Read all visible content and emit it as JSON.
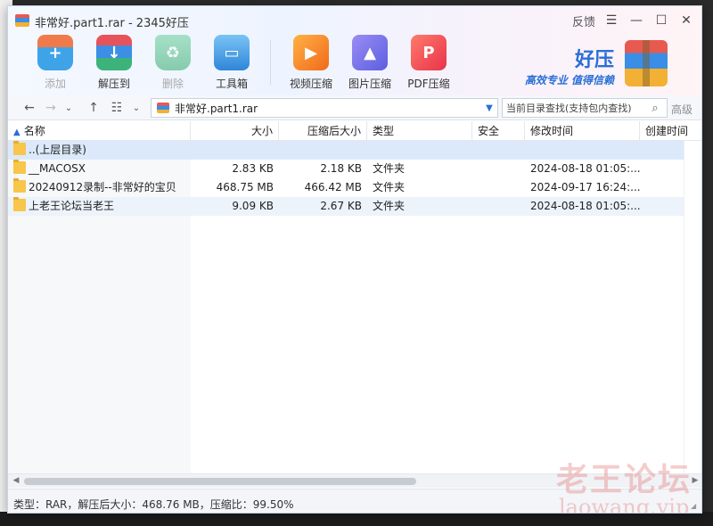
{
  "window": {
    "title": "非常好.part1.rar - 2345好压",
    "feedback_label": "反馈",
    "menu_icon": "hamburger-icon",
    "minimize_icon": "minimize-icon",
    "maximize_icon": "maximize-icon",
    "close_icon": "close-icon"
  },
  "toolbar": {
    "add_label": "添加",
    "extract_label": "解压到",
    "delete_label": "删除",
    "toolbox_label": "工具箱",
    "video_label": "视频压缩",
    "image_label": "图片压缩",
    "pdf_label": "PDF压缩"
  },
  "brand": {
    "name": "好压",
    "slogan": "高效专业  值得信赖"
  },
  "nav": {
    "path": "非常好.part1.rar",
    "search_placeholder": "当前目录查找(支持包内查找)",
    "advanced_label": "高级"
  },
  "table": {
    "headers": {
      "name": "名称",
      "size": "大小",
      "packed": "压缩后大小",
      "type": "类型",
      "security": "安全",
      "modified": "修改时间",
      "created": "创建时间"
    },
    "rows": [
      {
        "name": "..(上层目录)",
        "size": "",
        "packed": "",
        "type": "",
        "modified": ""
      },
      {
        "name": "__MACOSX",
        "size": "2.83 KB",
        "packed": "2.18 KB",
        "type": "文件夹",
        "modified": "2024-08-18 01:05:..."
      },
      {
        "name": "20240912录制--非常好的宝贝",
        "size": "468.75 MB",
        "packed": "466.42 MB",
        "type": "文件夹",
        "modified": "2024-09-17 16:24:..."
      },
      {
        "name": "上老王论坛当老王",
        "size": "9.09 KB",
        "packed": "2.67 KB",
        "type": "文件夹",
        "modified": "2024-08-18 01:05:..."
      }
    ]
  },
  "status": {
    "text": "类型：RAR，解压后大小：468.76 MB，压缩比：99.50%"
  },
  "watermark": {
    "cn": "老王论坛",
    "en": "laowang.vip"
  },
  "colors": {
    "accent": "#2a6fd6",
    "selected_row": "#dbe9fb",
    "folder": "#f7c64a"
  }
}
